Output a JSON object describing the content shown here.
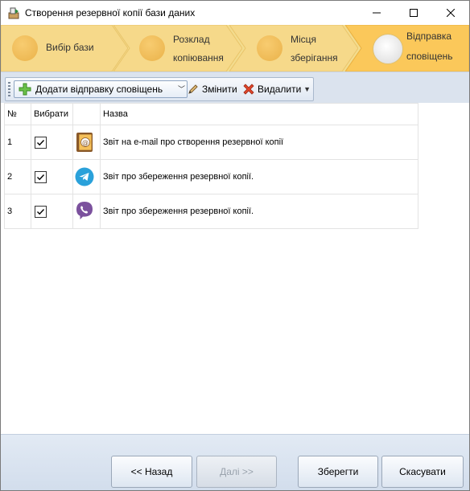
{
  "window": {
    "title": "Створення резервної копії бази даних",
    "controls": {
      "minimize": "—",
      "maximize": "☐",
      "close": "✕"
    }
  },
  "wizard": {
    "steps": [
      {
        "line1": "Вибір бази",
        "line2": "",
        "active": false
      },
      {
        "line1": "Розклад",
        "line2": "копіювання",
        "active": false
      },
      {
        "line1": "Місця",
        "line2": "зберігання",
        "active": false
      },
      {
        "line1": "Відправка",
        "line2": "сповіщень",
        "active": true
      }
    ]
  },
  "toolbar": {
    "add_label": "Додати відправку сповіщень",
    "edit_label": "Змінити",
    "delete_label": "Видалити"
  },
  "grid": {
    "columns": {
      "num": "№",
      "select": "Вибрати",
      "icon": "",
      "name": "Назва"
    },
    "rows": [
      {
        "num": "1",
        "checked": true,
        "icon": "email-icon",
        "name": "Звіт на e-mail про створення резервної копії"
      },
      {
        "num": "2",
        "checked": true,
        "icon": "telegram-icon",
        "name": "Звіт про збереження резервної копії."
      },
      {
        "num": "3",
        "checked": true,
        "icon": "viber-icon",
        "name": "Звіт про збереження резервної копії."
      }
    ]
  },
  "buttons": {
    "back": "<< Назад",
    "next": "Далі >>",
    "save": "Зберегти",
    "cancel": "Скасувати"
  },
  "colors": {
    "step_bg": "#f3dc8e",
    "step_active": "#fbc85a",
    "telegram": "#2aa1da",
    "viber": "#7b519d"
  }
}
